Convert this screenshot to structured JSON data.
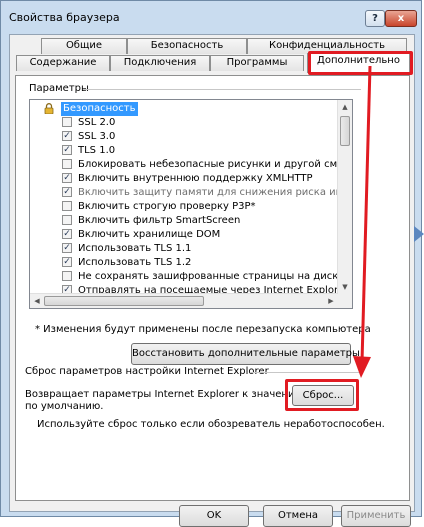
{
  "window": {
    "title": "Свойства браузера",
    "help_glyph": "?",
    "close_glyph": "x"
  },
  "tabs": {
    "row1": [
      "Общие",
      "Безопасность",
      "Конфиденциальность"
    ],
    "row2": [
      "Содержание",
      "Подключения",
      "Программы",
      "Дополнительно"
    ],
    "active": "Дополнительно"
  },
  "settings": {
    "group_label": "Параметры",
    "category": "Безопасность",
    "items": [
      {
        "label": "SSL 2.0",
        "checked": false,
        "enabled": true
      },
      {
        "label": "SSL 3.0",
        "checked": true,
        "enabled": true
      },
      {
        "label": "TLS 1.0",
        "checked": true,
        "enabled": true
      },
      {
        "label": "Блокировать небезопасные рисунки и другой смешанн",
        "checked": false,
        "enabled": true
      },
      {
        "label": "Включить внутреннюю поддержку XMLHTTP",
        "checked": true,
        "enabled": true
      },
      {
        "label": "Включить защиту памяти для снижения риска интерн",
        "checked": true,
        "enabled": false
      },
      {
        "label": "Включить строгую проверку P3P*",
        "checked": false,
        "enabled": true
      },
      {
        "label": "Включить фильтр SmartScreen",
        "checked": false,
        "enabled": true
      },
      {
        "label": "Включить хранилище DOM",
        "checked": true,
        "enabled": true
      },
      {
        "label": "Использовать TLS 1.1",
        "checked": true,
        "enabled": true
      },
      {
        "label": "Использовать TLS 1.2",
        "checked": true,
        "enabled": true
      },
      {
        "label": "Не сохранять зашифрованные страницы на диск",
        "checked": false,
        "enabled": true
      },
      {
        "label": "Отправлять на посещаемые через Internet Explorer ве",
        "checked": true,
        "enabled": true
      }
    ],
    "note": "* Изменения будут применены после перезапуска компьютера",
    "restore_button": "Восстановить дополнительные параметры"
  },
  "reset": {
    "group_label": "Сброс параметров настройки Internet Explorer",
    "description_line1": "Возвращает параметры Internet Explorer к значениям",
    "description_line2": "по умолчанию.",
    "button": "Сброс...",
    "hint": "Используйте сброс только если обозреватель неработоспособен."
  },
  "footer": {
    "ok": "OK",
    "cancel": "Отмена",
    "apply": "Применить"
  },
  "colors": {
    "annotation_red": "#e11b22",
    "selection_blue": "#3399ff",
    "window_frame": "#c9dcef"
  }
}
